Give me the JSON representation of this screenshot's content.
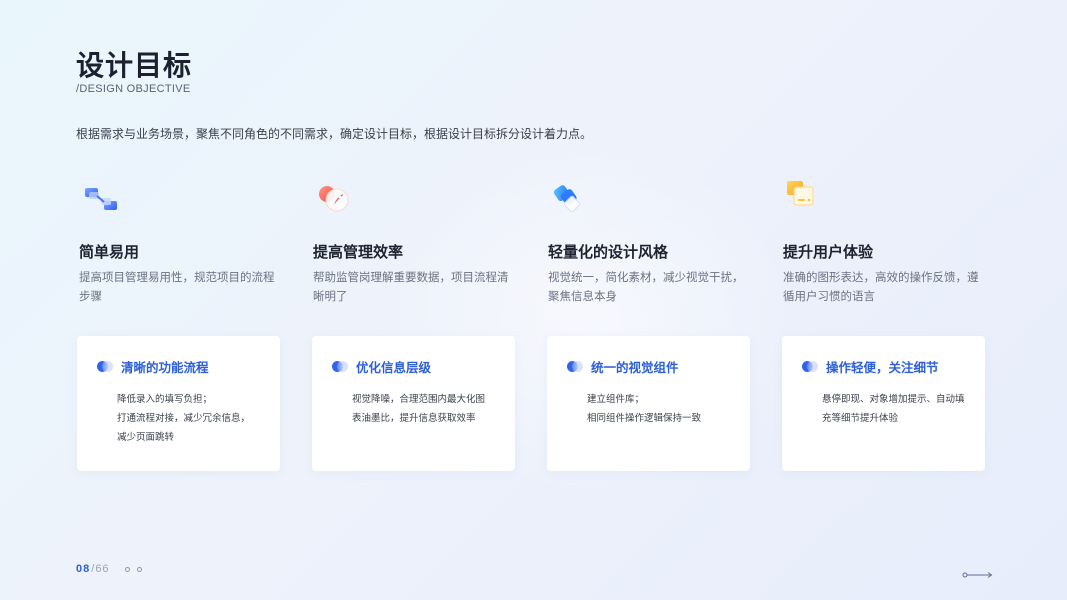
{
  "page": {
    "title": "设计目标",
    "subtitle": "/DESIGN OBJECTIVE",
    "intro": "根据需求与业务场景，聚焦不同角色的不同需求，确定设计目标，根据设计目标拆分设计着力点。"
  },
  "columns": [
    {
      "icon": "layers-transfer-icon",
      "title": "简单易用",
      "desc_lines": [
        "提高项目管理易用性，规范项目的流程",
        "步骤"
      ],
      "card": {
        "title": "清晰的功能流程",
        "lines": [
          "降低录入的填写负担；",
          "打通流程对接，减少冗余信息，",
          "减少页面跳转"
        ]
      }
    },
    {
      "icon": "rocket-icon",
      "title": "提高管理效率",
      "desc_lines": [
        "帮助监管岗理解重要数据，项目流程清",
        "晰明了"
      ],
      "card": {
        "title": "优化信息层级",
        "lines": [
          "视觉降噪，合理范围内最大化图",
          "表油墨比，提升信息获取效率"
        ]
      }
    },
    {
      "icon": "diamond-layers-icon",
      "title": "轻量化的设计风格",
      "desc_lines": [
        "视觉统一，简化素材，减少视觉干扰，",
        "聚焦信息本身"
      ],
      "card": {
        "title": "统一的视觉组件",
        "lines": [
          "建立组件库；",
          "相同组件操作逻辑保持一致"
        ]
      }
    },
    {
      "icon": "message-cards-icon",
      "title": "提升用户体验",
      "desc_lines": [
        "准确的图形表达，高效的操作反馈，遵",
        "循用户习惯的语言"
      ],
      "card": {
        "title": "操作轻便，关注细节",
        "lines": [
          "悬停即现、对象增加提示、自动填",
          "充等细节提升体验"
        ]
      }
    }
  ],
  "footer": {
    "current_page": "08",
    "separator": "/",
    "total_pages": "66"
  },
  "colors": {
    "accent": "#2d5fd8",
    "title": "#1c2130",
    "muted": "#6b7280"
  }
}
